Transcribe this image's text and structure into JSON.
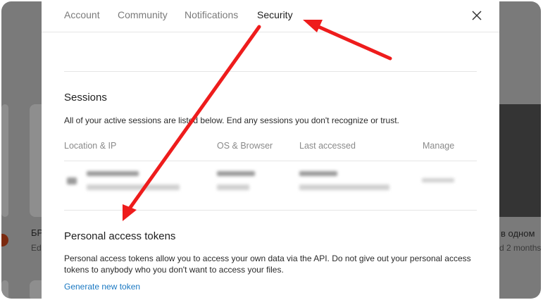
{
  "tabs": [
    {
      "label": "Account"
    },
    {
      "label": "Community"
    },
    {
      "label": "Notifications"
    },
    {
      "label": "Security"
    }
  ],
  "active_tab": "Security",
  "sessions": {
    "title": "Sessions",
    "description": "All of your active sessions are listed below. End any sessions you don't recognize or trust.",
    "columns": [
      "Location & IP",
      "OS & Browser",
      "Last accessed",
      "Manage"
    ]
  },
  "tokens": {
    "title": "Personal access tokens",
    "description": "Personal access tokens allow you to access your own data via the API. Do not give out your personal access tokens to anybody who you don't want to access your files.",
    "generate_label": "Generate new token"
  },
  "background": {
    "left_card_title": "БР",
    "left_card_sub": "Edi",
    "right_card_title": "в одном",
    "right_card_sub": "d 2 months"
  },
  "colors": {
    "arrow": "#ee1c1c",
    "link": "#1a78c2",
    "overlay": "#7a7a7a"
  }
}
